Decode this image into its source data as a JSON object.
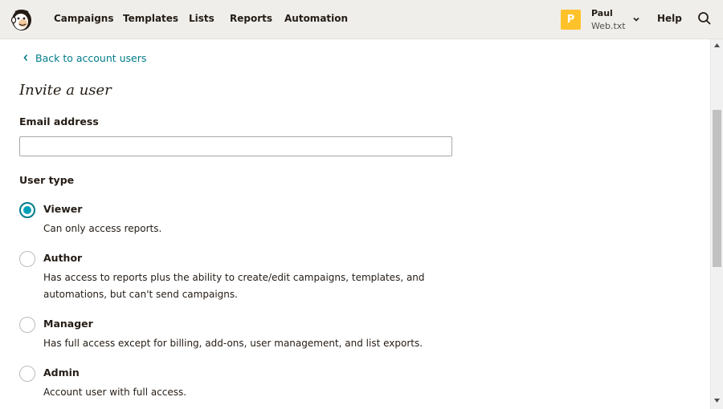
{
  "nav": {
    "items": [
      {
        "label": "Campaigns"
      },
      {
        "label": "Templates"
      },
      {
        "label": "Lists"
      },
      {
        "label": "Reports"
      },
      {
        "label": "Automation"
      }
    ],
    "avatar_letter": "P",
    "user_name": "Paul",
    "account_name": "Web.txt",
    "help_label": "Help"
  },
  "main": {
    "back_link": "Back to account users",
    "title": "Invite a user",
    "email_label": "Email address",
    "email_value": "",
    "user_type_label": "User type",
    "user_types": [
      {
        "label": "Viewer",
        "description": "Can only access reports.",
        "selected": true
      },
      {
        "label": "Author",
        "description": "Has access to reports plus the ability to create/edit campaigns, templates, and automations, but can't send campaigns.",
        "selected": false
      },
      {
        "label": "Manager",
        "description": "Has full access except for billing, add-ons, user management, and list exports.",
        "selected": false
      },
      {
        "label": "Admin",
        "description": "Account user with full access.",
        "selected": false
      }
    ]
  },
  "colors": {
    "nav_background": "#efeeea",
    "link": "#007c89",
    "radio_selected": "#00a0b8",
    "avatar": "#ffc22b"
  },
  "icons": {
    "logo": "mailchimp-freddie-logo",
    "user_menu": "chevron-down-icon",
    "search": "search-icon",
    "back": "chevron-left-icon"
  }
}
